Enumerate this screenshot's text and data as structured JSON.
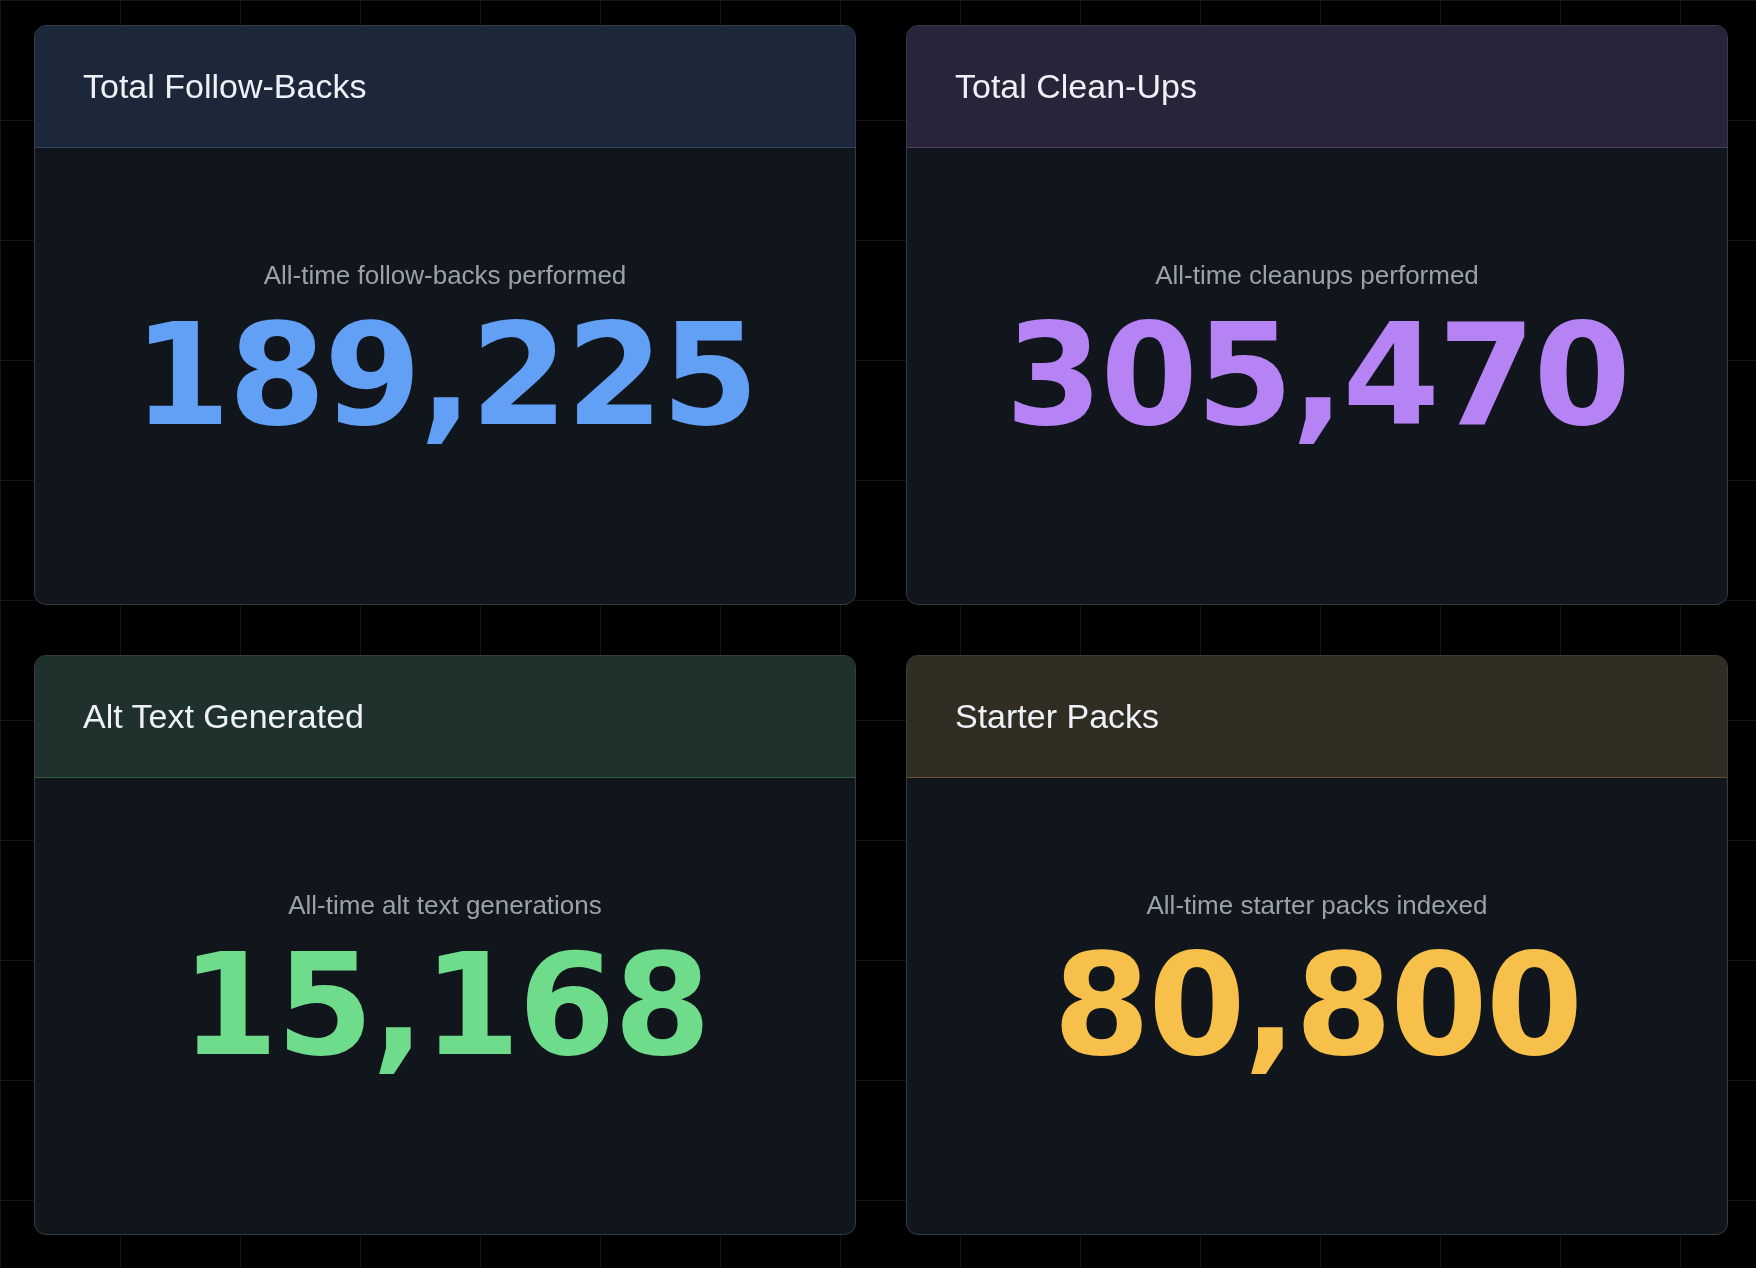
{
  "cards": [
    {
      "title": "Total Follow-Backs",
      "caption": "All-time follow-backs performed",
      "value": "189,225",
      "color": "#62a0f5"
    },
    {
      "title": "Total Clean-Ups",
      "caption": "All-time cleanups performed",
      "value": "305,470",
      "color": "#b683f5"
    },
    {
      "title": "Alt Text Generated",
      "caption": "All-time alt text generations",
      "value": "15,168",
      "color": "#6fdc8c"
    },
    {
      "title": "Starter Packs",
      "caption": "All-time starter packs indexed",
      "value": "80,800",
      "color": "#f6c04a"
    }
  ]
}
